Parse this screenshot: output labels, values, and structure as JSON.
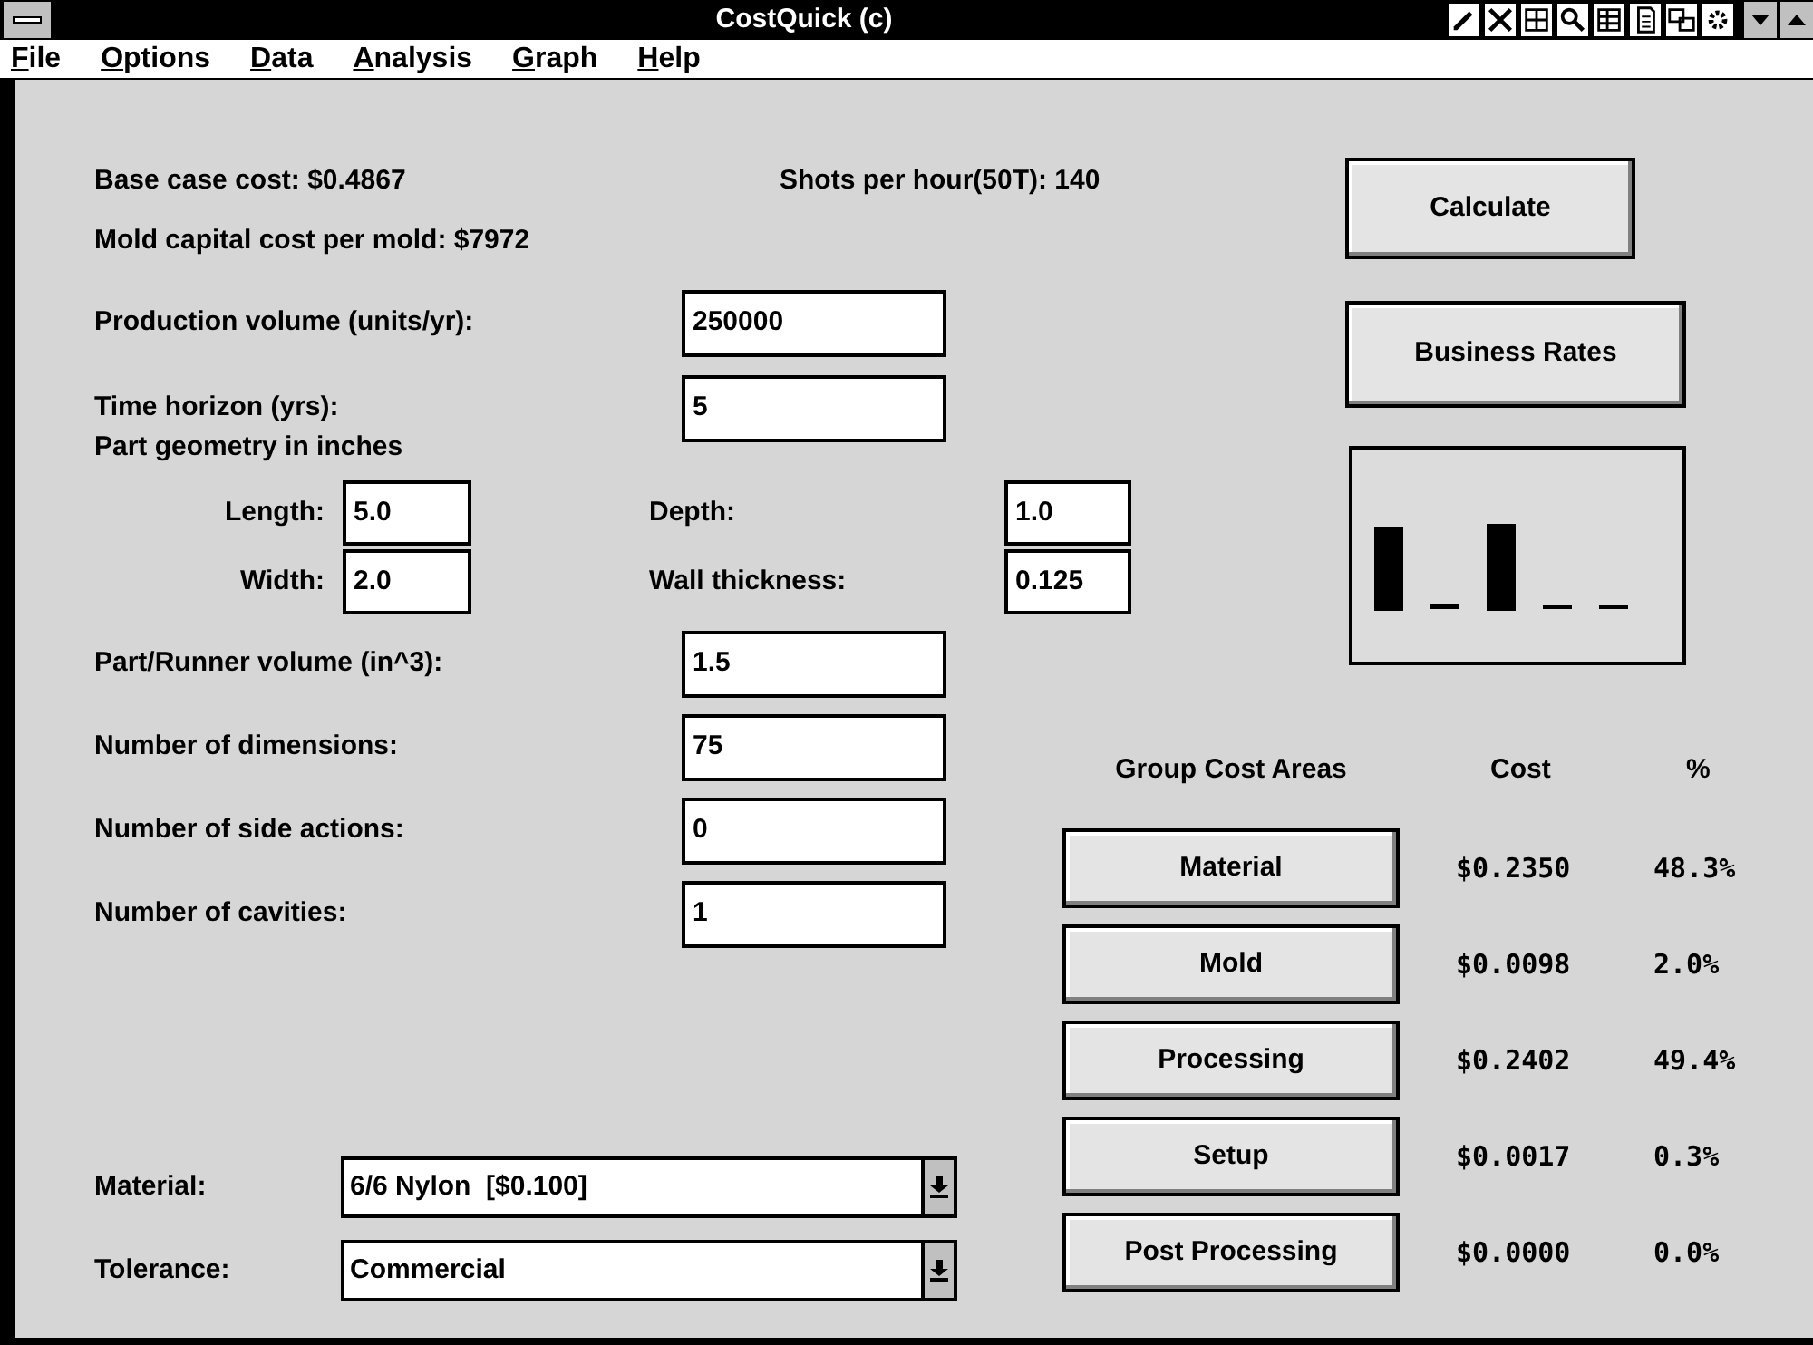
{
  "window": {
    "title": "CostQuick (c)"
  },
  "menu": [
    "File",
    "Options",
    "Data",
    "Analysis",
    "Graph",
    "Help"
  ],
  "summary": {
    "base_case_cost": "Base case cost: $0.4867",
    "shots_per_hour": "Shots per hour(50T): 140",
    "mold_capital_cost": "Mold capital cost per mold: $7972"
  },
  "inputs_top": [
    {
      "label": "Production volume (units/yr):",
      "value": "250000"
    },
    {
      "label": "Time horizon (yrs):",
      "value": "5"
    }
  ],
  "geometry": {
    "heading": "Part geometry in inches",
    "fields": [
      {
        "label": "Length:",
        "value": "5.0"
      },
      {
        "label": "Depth:",
        "value": "1.0"
      },
      {
        "label": "Width:",
        "value": "2.0"
      },
      {
        "label": "Wall thickness:",
        "value": "0.125"
      }
    ]
  },
  "inputs_bottom": [
    {
      "label": "Part/Runner volume (in^3):",
      "value": "1.5"
    },
    {
      "label": "Number of dimensions:",
      "value": "75"
    },
    {
      "label": "Number of side actions:",
      "value": "0"
    },
    {
      "label": "Number of cavities:",
      "value": "1"
    }
  ],
  "dropdowns": [
    {
      "label": "Material:",
      "value": "6/6 Nylon  [$0.100]"
    },
    {
      "label": "Tolerance:",
      "value": "Commercial"
    }
  ],
  "buttons": [
    "Calculate",
    "Business Rates"
  ],
  "cost_table": {
    "columns": [
      "Group Cost Areas",
      "Cost",
      "%"
    ],
    "rows": [
      {
        "area": "Material",
        "cost": "$0.2350",
        "percent": "48.3%"
      },
      {
        "area": "Mold",
        "cost": "$0.0098",
        "percent": "2.0%"
      },
      {
        "area": "Processing",
        "cost": "$0.2402",
        "percent": "49.4%"
      },
      {
        "area": "Setup",
        "cost": "$0.0017",
        "percent": "0.3%"
      },
      {
        "area": "Post Processing",
        "cost": "$0.0000",
        "percent": "0.0%"
      }
    ]
  }
}
